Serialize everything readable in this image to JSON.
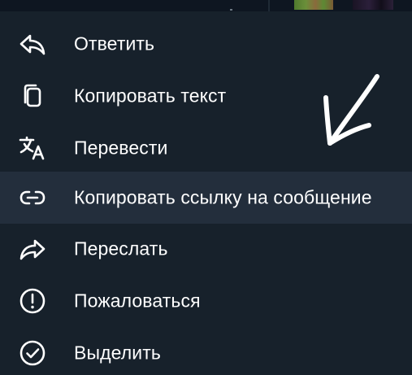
{
  "menu": {
    "items": [
      {
        "label": "Ответить",
        "icon": "reply-icon"
      },
      {
        "label": "Копировать текст",
        "icon": "copy-icon"
      },
      {
        "label": "Перевести",
        "icon": "translate-icon"
      },
      {
        "label": "Копировать ссылку на сообщение",
        "icon": "link-icon",
        "highlighted": true
      },
      {
        "label": "Переслать",
        "icon": "forward-icon"
      },
      {
        "label": "Пожаловаться",
        "icon": "report-icon"
      },
      {
        "label": "Выделить",
        "icon": "select-icon"
      }
    ]
  },
  "colors": {
    "menu_background": "#17212b",
    "highlight_background": "#232e3c",
    "text": "#ffffff"
  }
}
